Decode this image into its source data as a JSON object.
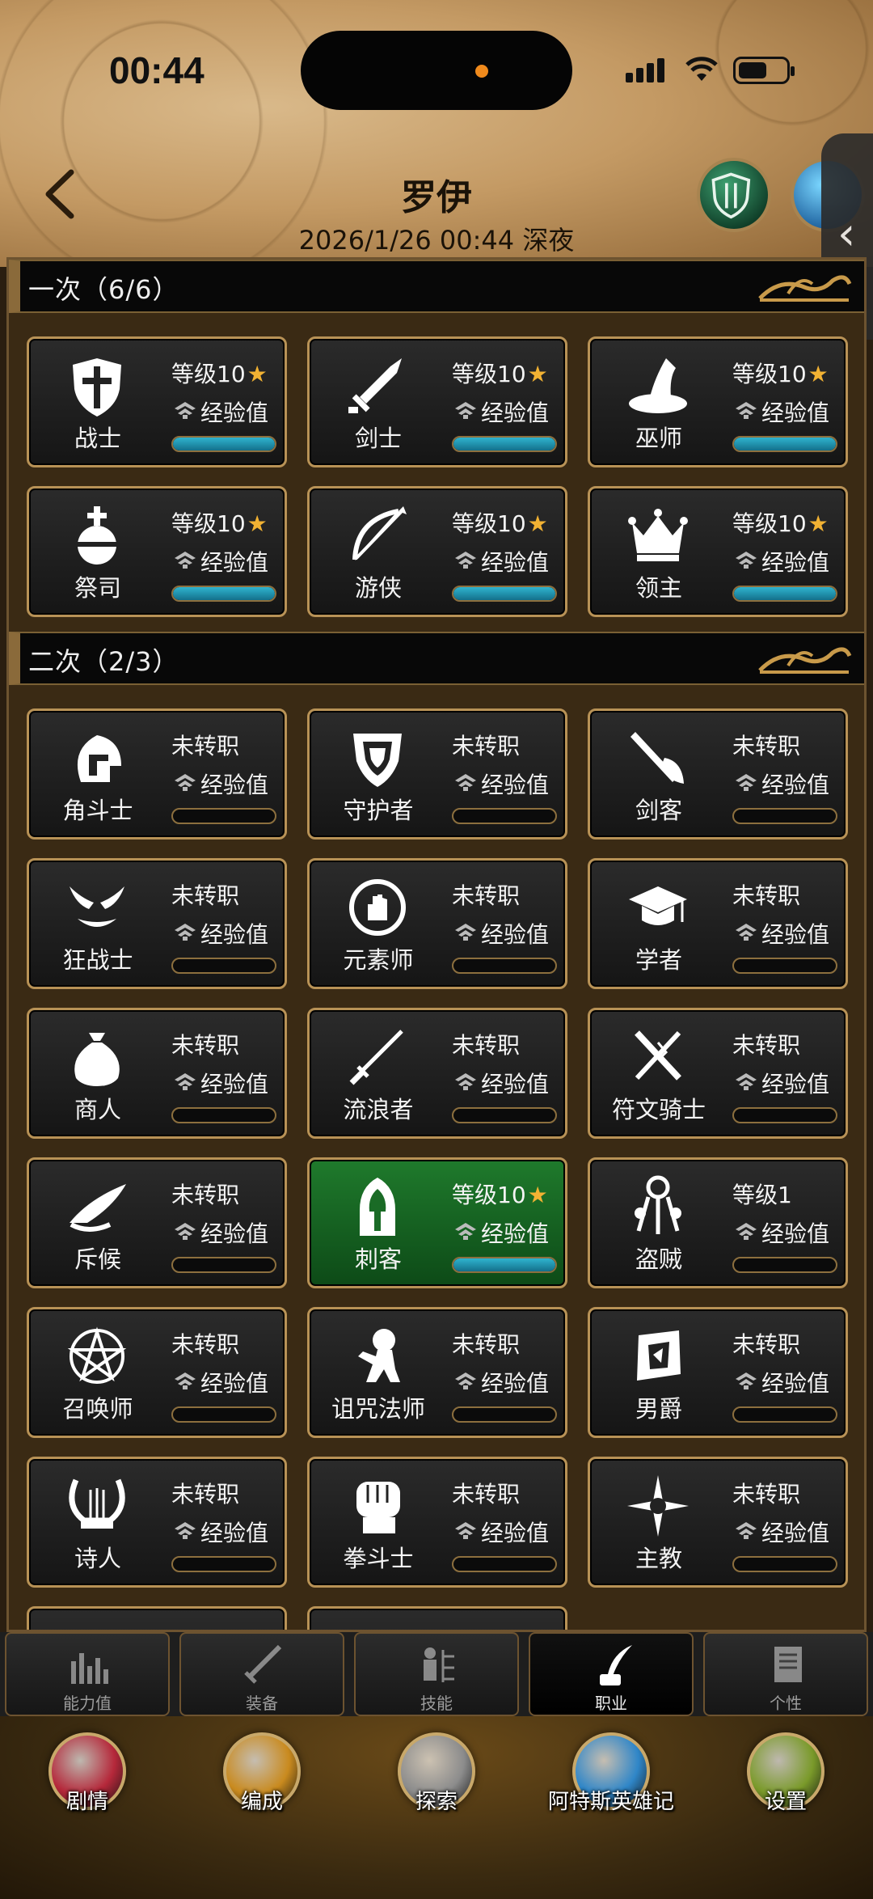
{
  "status_bar": {
    "time": "00:44"
  },
  "header": {
    "title": "罗伊",
    "subtitle": "2026/1/26 00:44 深夜"
  },
  "sections": [
    {
      "label": "一次（6/6）"
    },
    {
      "label": "二次（2/3）"
    }
  ],
  "primary_jobs": [
    {
      "name": "战士",
      "level": "等级10",
      "exp": "经验值",
      "icon": "shield-cross-icon",
      "starred": true,
      "progress": 1.0
    },
    {
      "name": "剑士",
      "level": "等级10",
      "exp": "经验值",
      "icon": "sword-icon",
      "starred": true,
      "progress": 1.0
    },
    {
      "name": "巫师",
      "level": "等级10",
      "exp": "经验值",
      "icon": "wizard-hat-icon",
      "starred": true,
      "progress": 1.0
    },
    {
      "name": "祭司",
      "level": "等级10",
      "exp": "经验值",
      "icon": "orb-cross-icon",
      "starred": true,
      "progress": 1.0
    },
    {
      "name": "游侠",
      "level": "等级10",
      "exp": "经验值",
      "icon": "bow-icon",
      "starred": true,
      "progress": 1.0
    },
    {
      "name": "领主",
      "level": "等级10",
      "exp": "经验值",
      "icon": "crown-icon",
      "starred": true,
      "progress": 1.0
    }
  ],
  "secondary_jobs": [
    {
      "name": "角斗士",
      "level": "未转职",
      "exp": "经验值",
      "icon": "gladiator-helmet-icon",
      "starred": false,
      "progress": 0
    },
    {
      "name": "守护者",
      "level": "未转职",
      "exp": "经验值",
      "icon": "guardian-shield-icon",
      "starred": false,
      "progress": 0
    },
    {
      "name": "剑客",
      "level": "未转职",
      "exp": "经验值",
      "icon": "swordsman-icon",
      "starred": false,
      "progress": 0
    },
    {
      "name": "狂战士",
      "level": "未转职",
      "exp": "经验值",
      "icon": "berserker-mask-icon",
      "starred": false,
      "progress": 0
    },
    {
      "name": "元素师",
      "level": "未转职",
      "exp": "经验值",
      "icon": "elemental-hand-icon",
      "starred": false,
      "progress": 0
    },
    {
      "name": "学者",
      "level": "未转职",
      "exp": "经验值",
      "icon": "graduation-cap-icon",
      "starred": false,
      "progress": 0
    },
    {
      "name": "商人",
      "level": "未转职",
      "exp": "经验值",
      "icon": "money-bag-icon",
      "starred": false,
      "progress": 0
    },
    {
      "name": "流浪者",
      "level": "未转职",
      "exp": "经验值",
      "icon": "katana-icon",
      "starred": false,
      "progress": 0
    },
    {
      "name": "符文骑士",
      "level": "未转职",
      "exp": "经验值",
      "icon": "rune-sword-icon",
      "starred": false,
      "progress": 0
    },
    {
      "name": "斥候",
      "level": "未转职",
      "exp": "经验值",
      "icon": "feather-hat-icon",
      "starred": false,
      "progress": 0
    },
    {
      "name": "刺客",
      "level": "等级10",
      "exp": "经验值",
      "icon": "hooded-assassin-icon",
      "starred": true,
      "progress": 1.0,
      "active": true
    },
    {
      "name": "盗贼",
      "level": "等级1",
      "exp": "经验值",
      "icon": "keys-icon",
      "starred": false,
      "progress": 0
    },
    {
      "name": "召唤师",
      "level": "未转职",
      "exp": "经验值",
      "icon": "pentagram-icon",
      "starred": false,
      "progress": 0
    },
    {
      "name": "诅咒法师",
      "level": "未转职",
      "exp": "经验值",
      "icon": "voodoo-doll-icon",
      "starred": false,
      "progress": 0
    },
    {
      "name": "男爵",
      "level": "未转职",
      "exp": "经验值",
      "icon": "baron-emblem-icon",
      "starred": false,
      "progress": 0
    },
    {
      "name": "诗人",
      "level": "未转职",
      "exp": "经验值",
      "icon": "lyre-icon",
      "starred": false,
      "progress": 0
    },
    {
      "name": "拳斗士",
      "level": "未转职",
      "exp": "经验值",
      "icon": "fist-icon",
      "starred": false,
      "progress": 0
    },
    {
      "name": "主教",
      "level": "未转职",
      "exp": "经验值",
      "icon": "bishop-star-icon",
      "starred": false,
      "progress": 0
    }
  ],
  "tabs": [
    {
      "label": "能力值",
      "icon": "bar-chart-icon",
      "selected": false
    },
    {
      "label": "装备",
      "icon": "sword-equip-icon",
      "selected": false
    },
    {
      "label": "技能",
      "icon": "skill-tree-icon",
      "selected": false
    },
    {
      "label": "职业",
      "icon": "quill-ink-icon",
      "selected": true
    },
    {
      "label": "个性",
      "icon": "scroll-icon",
      "selected": false
    }
  ],
  "bottom_nav": [
    {
      "label": "剧情",
      "icon": "dragon-icon",
      "color": "#b5283a"
    },
    {
      "label": "编成",
      "icon": "eagle-emblem-icon",
      "color": "#c98a1e"
    },
    {
      "label": "探索",
      "icon": "map-icon",
      "color": "#8c8c8c"
    },
    {
      "label": "阿特斯英雄记",
      "icon": "letter-icon",
      "color": "#2f86c8"
    },
    {
      "label": "设置",
      "icon": "settings-gear-icon",
      "color": "#7a9a2a"
    }
  ],
  "colors": {
    "accent_gold": "#b89256",
    "progress_fill": "#2fb4cf",
    "active_card": "#1f7a2c",
    "star": "#f2b233"
  }
}
